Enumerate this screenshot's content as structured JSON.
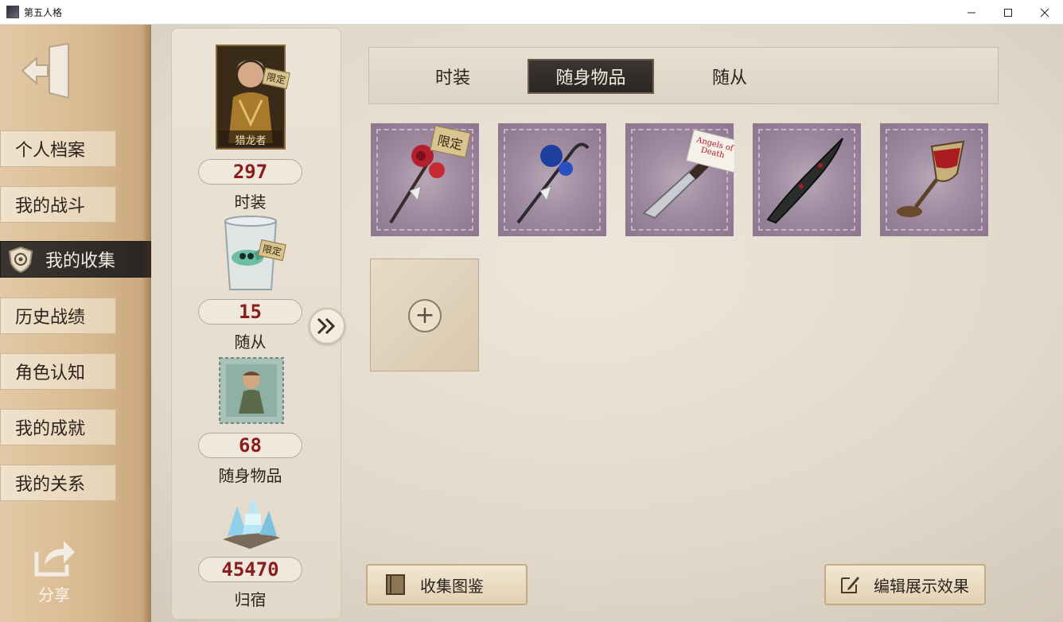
{
  "window": {
    "title": "第五人格"
  },
  "nav": {
    "items": [
      "个人档案",
      "我的战斗",
      "我的收集",
      "历史战绩",
      "角色认知",
      "我的成就",
      "我的关系"
    ],
    "active_index": 2,
    "share_label": "分享"
  },
  "stats": {
    "costume": {
      "tag": "限定",
      "name": "猎龙者",
      "count": "297",
      "label": "时装"
    },
    "pet": {
      "tag": "限定",
      "count": "15",
      "label": "随从"
    },
    "accessory": {
      "count": "68",
      "label": "随身物品"
    },
    "home": {
      "count": "45470",
      "label": "归宿"
    }
  },
  "tabs": {
    "items": [
      "时装",
      "随身物品",
      "随从"
    ],
    "active_index": 1
  },
  "items": [
    {
      "name": "red-rose-staff",
      "tag": "限定"
    },
    {
      "name": "blue-rose-cane"
    },
    {
      "name": "knife",
      "sign_text": "Angels of Death"
    },
    {
      "name": "thorn-blade"
    },
    {
      "name": "goblet"
    }
  ],
  "buttons": {
    "collection": "收集图鉴",
    "edit_display": "编辑展示效果"
  }
}
